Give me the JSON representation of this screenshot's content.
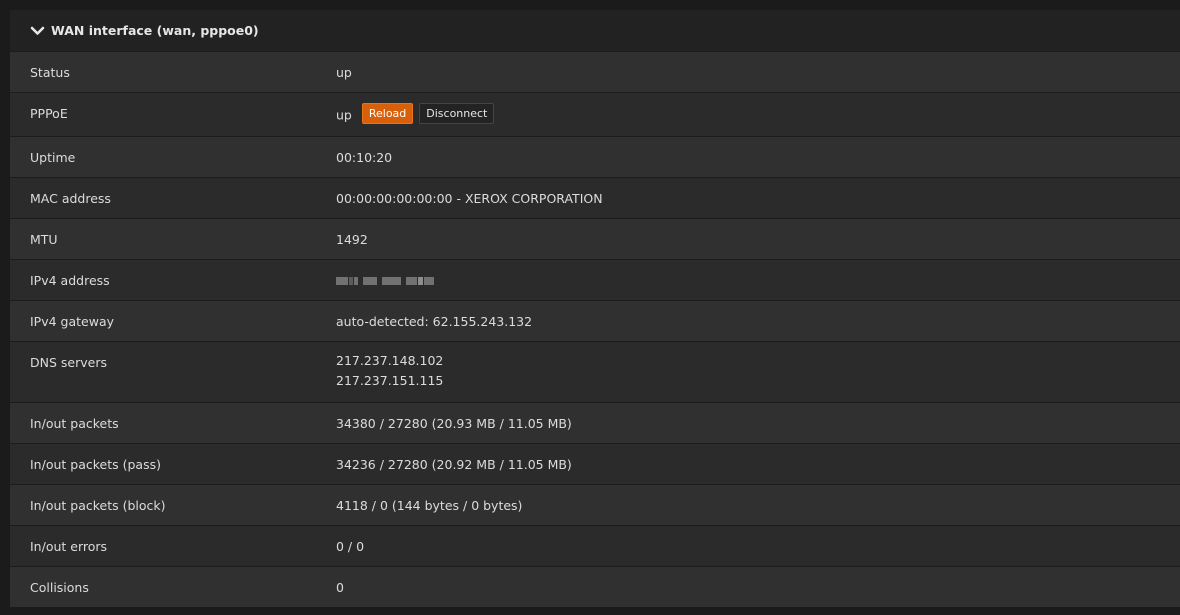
{
  "panel": {
    "title": "WAN interface (wan, pppoe0)",
    "collapse_icon": "chevron-down-icon"
  },
  "rows": {
    "status": {
      "label": "Status",
      "value": "up"
    },
    "pppoe": {
      "label": "PPPoE",
      "value": "up",
      "reload_label": "Reload",
      "disconnect_label": "Disconnect"
    },
    "uptime": {
      "label": "Uptime",
      "value": "00:10:20"
    },
    "mac": {
      "label": "MAC address",
      "value": "00:00:00:00:00:00 - XEROX CORPORATION"
    },
    "mtu": {
      "label": "MTU",
      "value": "1492"
    },
    "ipv4_address": {
      "label": "IPv4 address",
      "value_redacted": true
    },
    "ipv4_gateway": {
      "label": "IPv4 gateway",
      "value": "auto-detected: 62.155.243.132"
    },
    "dns": {
      "label": "DNS servers",
      "values": [
        "217.237.148.102",
        "217.237.151.115"
      ]
    },
    "packets": {
      "label": "In/out packets",
      "value": "34380 / 27280 (20.93 MB / 11.05 MB)"
    },
    "packets_pass": {
      "label": "In/out packets (pass)",
      "value": "34236 / 27280 (20.92 MB / 11.05 MB)"
    },
    "packets_block": {
      "label": "In/out packets (block)",
      "value": "4118 / 0 (144 bytes / 0 bytes)"
    },
    "errors": {
      "label": "In/out errors",
      "value": "0 / 0"
    },
    "collisions": {
      "label": "Collisions",
      "value": "0"
    }
  },
  "colors": {
    "accent": "#d9600b",
    "header_bg": "#222222",
    "row_bg": "#2b2b2b",
    "row_alt_bg": "#303030"
  }
}
